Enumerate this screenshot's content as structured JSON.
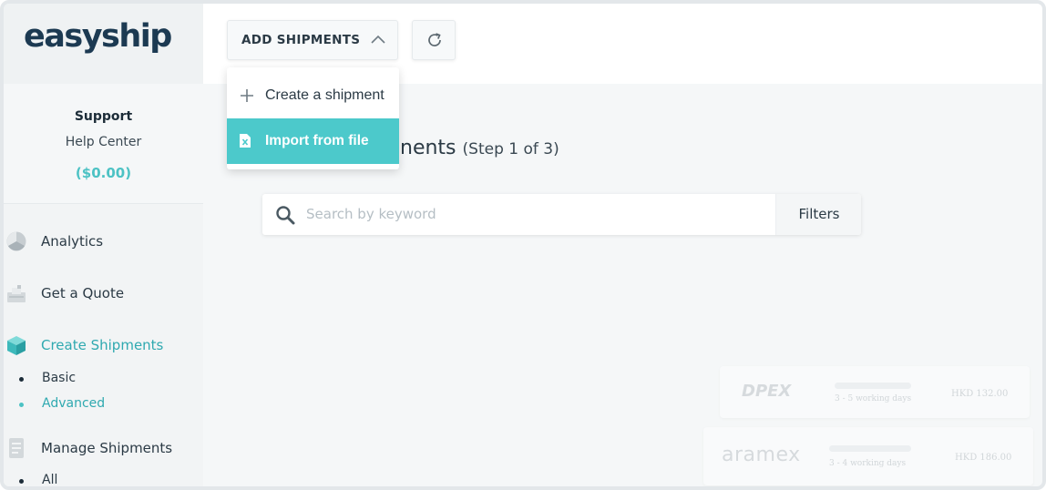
{
  "brand": {
    "logo_text": "easyship",
    "accent_color": "#4cc2c4"
  },
  "sidebar": {
    "support_title": "Support",
    "help_center": "Help Center",
    "credit": "($0.00)",
    "items": [
      {
        "label": "Analytics",
        "icon": "analytics-icon"
      },
      {
        "label": "Get a Quote",
        "icon": "quote-icon"
      },
      {
        "label": "Create Shipments",
        "icon": "box-icon",
        "active": true,
        "children": [
          {
            "label": "Basic"
          },
          {
            "label": "Advanced",
            "active": true
          }
        ]
      },
      {
        "label": "Manage Shipments",
        "icon": "document-icon",
        "children": [
          {
            "label": "All"
          }
        ]
      }
    ]
  },
  "toolbar": {
    "add_shipments_label": "ADD SHIPMENTS",
    "add_shipments_icon": "chevron-up-icon",
    "refresh_icon": "refresh-icon"
  },
  "dropdown": {
    "items": [
      {
        "label": "Create a shipment",
        "icon": "plus-icon"
      },
      {
        "label": "Import from file",
        "icon": "file-icon",
        "highlighted": true
      }
    ]
  },
  "main": {
    "title_partial": "nents",
    "step": "(Step 1 of 3)",
    "search": {
      "placeholder": "Search by keyword",
      "value": ""
    },
    "filters_label": "Filters",
    "carriers": [
      {
        "name": "DPEX",
        "days": "3 - 5 working days",
        "price": "HKD 132.00"
      },
      {
        "name": "aramex",
        "days": "3 - 4 working days",
        "price": "HKD 186.00"
      }
    ]
  }
}
